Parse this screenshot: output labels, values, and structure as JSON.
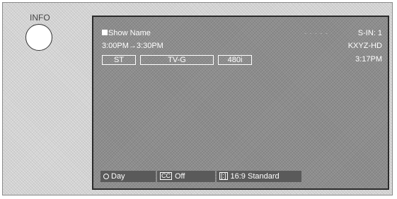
{
  "info_button": {
    "label": "INFO"
  },
  "banner": {
    "show_name": "Show Name",
    "input": "S-IN: 1",
    "time_range": "3:00PM→3:30PM",
    "station": "KXYZ-HD",
    "audio": "ST",
    "rating": "TV-G",
    "resolution": "480i",
    "current_time": "3:17PM"
  },
  "status_bar": {
    "timer": "Day",
    "timer_icon": "clock-icon",
    "cc_icon_text": "CC",
    "cc": "Off",
    "aspect_icon_text": "[:]",
    "aspect": "16:9 Standard"
  }
}
